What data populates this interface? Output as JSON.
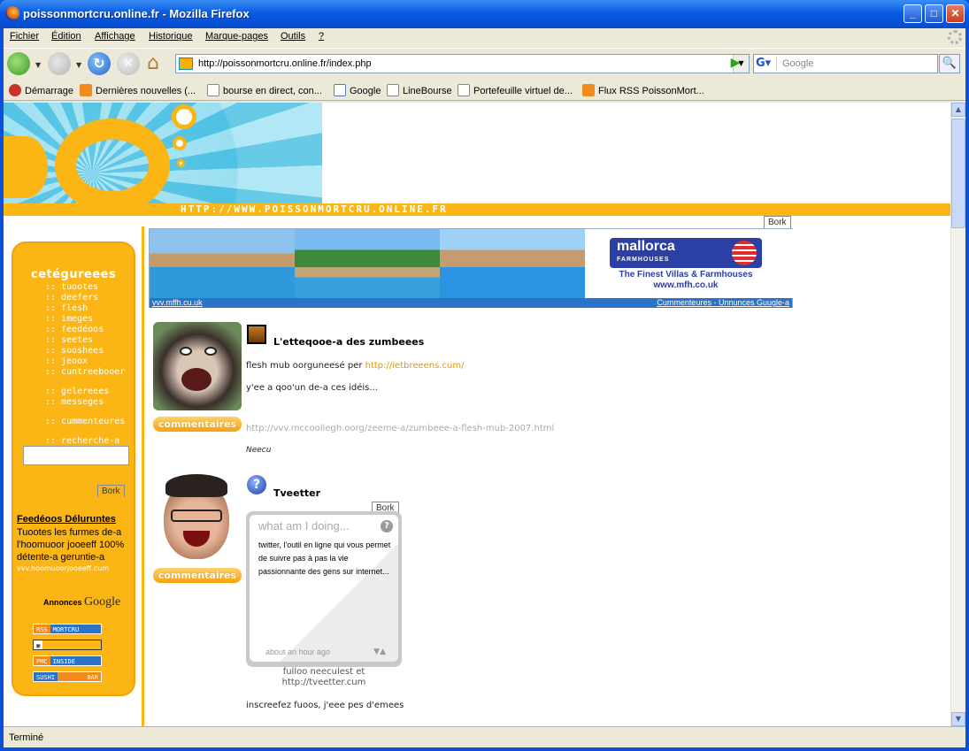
{
  "window": {
    "title": "poissonmortcru.online.fr - Mozilla Firefox"
  },
  "menu": [
    "Fichier",
    "Édition",
    "Affichage",
    "Historique",
    "Marque-pages",
    "Outils",
    "?"
  ],
  "nav": {
    "url": "http://poissonmortcru.online.fr/index.php",
    "search_placeholder": "Google"
  },
  "bookmarks": [
    "Démarrage",
    "Dernières nouvelles (...",
    "bourse en direct, con...",
    "Google",
    "LineBourse",
    "Portefeuille virtuel de...",
    "Flux RSS PoissonMort..."
  ],
  "status": "Terminé",
  "header": {
    "url_text": "HTTP://WWW.POISSONMORTCRU.ONLINE.FR"
  },
  "sidebar": {
    "title": "cetégureees",
    "items": [
      ":: tuootes",
      ":: deefers",
      ":: flesh",
      ":: imeges",
      ":: feedéoos",
      ":: seetes",
      ":: sooshees",
      ":: jeoox",
      ":: cuntreebooer"
    ],
    "items2": [
      ":: gelereees",
      ":: messeges"
    ],
    "items3": [
      ":: cummenteures"
    ],
    "items4": [
      ":: recherche-a"
    ],
    "bork": "Bork",
    "feed_title": "Feedéoos Déluruntes",
    "feed_desc": "Tuootes les furmes de-a l'hoomuoor jooeeff 100% détente-a geruntie-a",
    "feed_url": "vvv.hoomuoorjooeeff.cum",
    "annonces": "Annonces",
    "annonces_brand": "Google",
    "badges": [
      [
        "RSS",
        "MORTCRU"
      ],
      [
        "",
        ""
      ],
      [
        "PMC",
        "INSIDE"
      ],
      [
        "SUSHI",
        "BAR"
      ]
    ]
  },
  "ad": {
    "bork": "Bork",
    "brand": "mallorca",
    "brand_sub": "FARMHOUSES",
    "tagline": "The Finest Villas & Farmhouses",
    "site": "www.mfh.co.uk",
    "foot_left": "vvv.mffh.cu.uk",
    "foot_right": "Cummenteures - Unnunces Guugle-a"
  },
  "posts": [
    {
      "title": "L'etteqooe-a des zumbeees",
      "line1_prefix": "flesh mub oorguneesé per ",
      "line1_link": "http://ietbreeens.cum/",
      "line2": "y'ee a qoo'un de-a ces idéis...",
      "url": "http://vvv.mccoollegh.oorg/zeeme-a/zumbeee-a-flesh-mub-2007.html",
      "author": "Neecu",
      "comments": "commentaires"
    },
    {
      "title": "Tveetter",
      "bork": "Bork",
      "widget_head": "what am I doing...",
      "widget_msg": "twitter, l'outil en ligne qui vous permet de suivre pas à pas la vie passionnante des gens sur internet...",
      "widget_time": "about an hour ago",
      "follow": "fulloo neeculest et http://tveetter.cum",
      "footer": "inscreefez fuoos, j'eee pes d'emees",
      "comments": "commentaires"
    }
  ],
  "colors": {
    "accent": "#fbb615",
    "link": "#e29a00",
    "xp_blue": "#0a50d8"
  }
}
